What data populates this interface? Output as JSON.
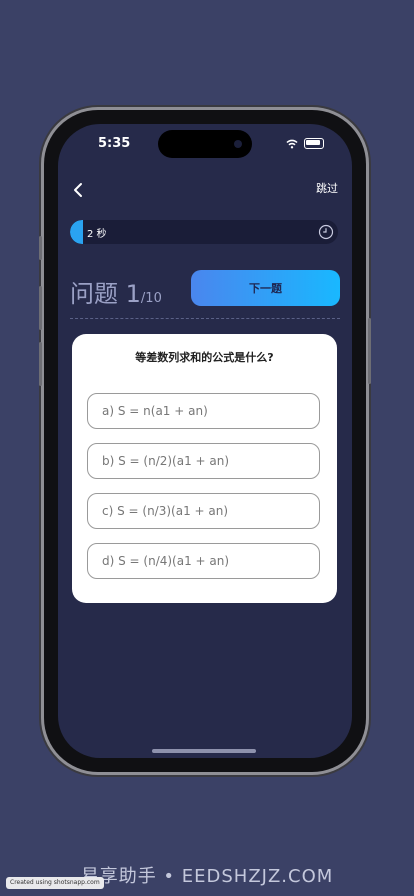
{
  "status_bar": {
    "time": "5:35"
  },
  "nav": {
    "skip_label": "跳过"
  },
  "timer": {
    "label": "2 秒",
    "fraction_remaining": 0.05
  },
  "quiz": {
    "title": "问题",
    "current": "1",
    "total": "/10",
    "next_label": "下一题",
    "question": "等差数列求和的公式是什么?",
    "options": [
      {
        "label": "a) S = n(a1 + an)"
      },
      {
        "label": "b) S = (n/2)(a1 + an)"
      },
      {
        "label": "c) S = (n/3)(a1 + an)"
      },
      {
        "label": "d) S = (n/4)(a1 + an)"
      }
    ]
  },
  "watermark": {
    "badge": "Created using shotsnapp.com",
    "text": "易享助手 • EEDSHZJZ.COM"
  }
}
